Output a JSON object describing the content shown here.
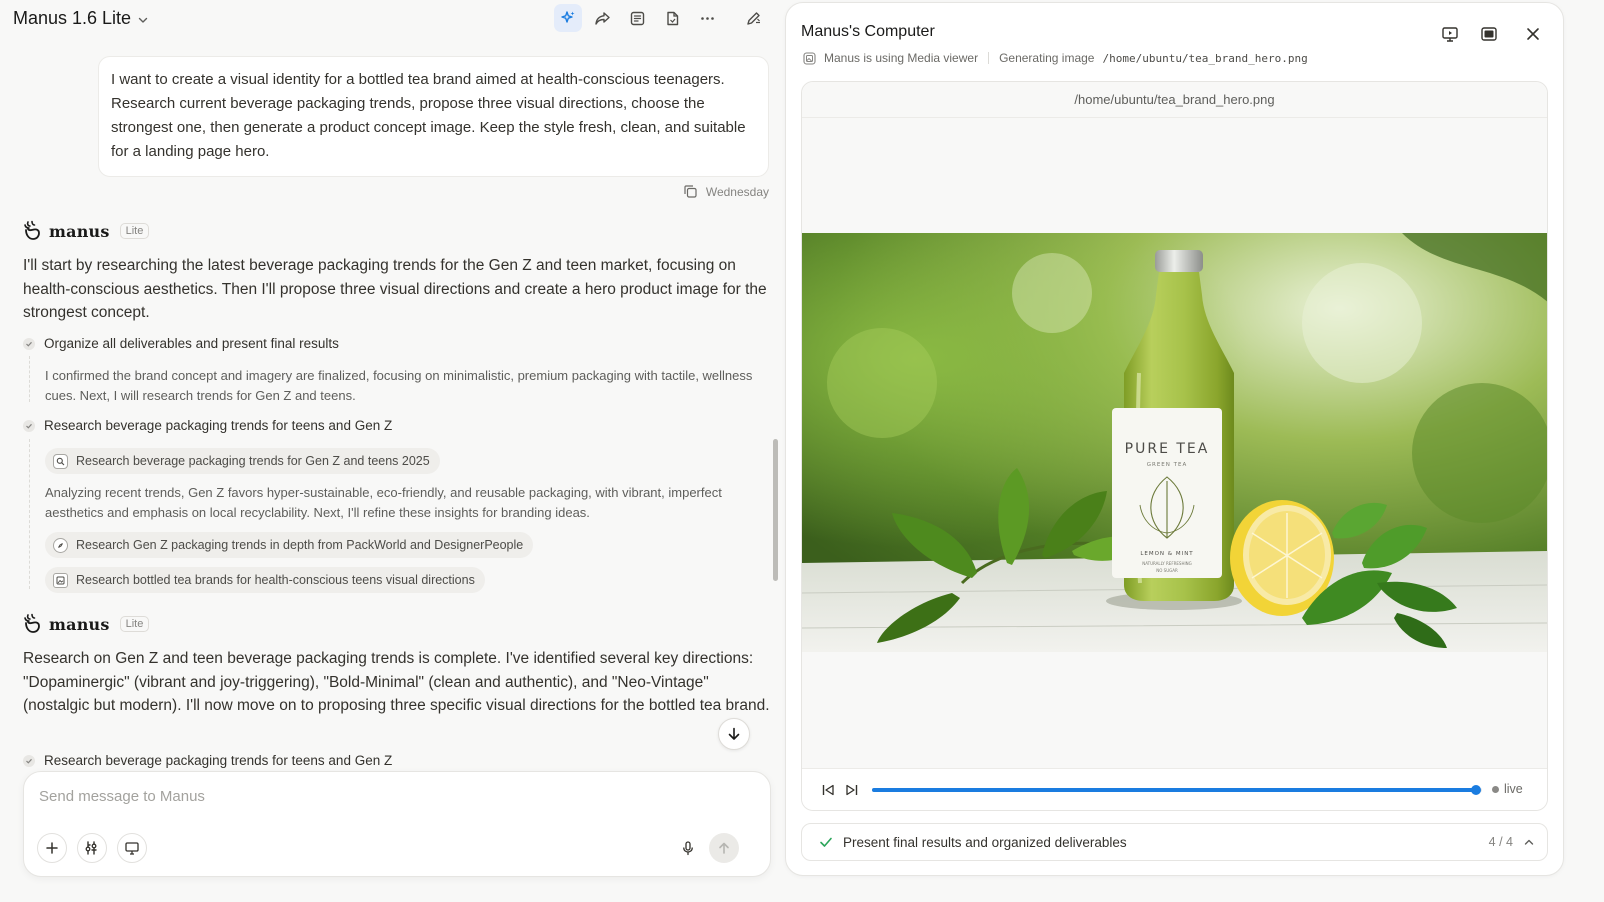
{
  "header": {
    "app_title": "Manus 1.6 Lite"
  },
  "user_message": {
    "text": "I want to create a visual identity for a bottled tea brand aimed at health-conscious teenagers. Research current beverage packaging trends, propose three visual directions, choose the strongest one, then generate a product concept image. Keep the style fresh, clean, and suitable for a landing page hero.",
    "day": "Wednesday"
  },
  "assistant_1": {
    "name": "manus",
    "badge": "Lite",
    "text": "I'll start by researching the latest beverage packaging trends for the Gen Z and teen market, focusing on health-conscious aesthetics. Then I'll propose three visual directions and create a hero product image for the strongest concept.",
    "step_1": {
      "title": "Organize all deliverables and present final results",
      "body": "I confirmed the brand concept and imagery are finalized, focusing on minimalistic, premium packaging with tactile, wellness cues. Next, I will research trends for Gen Z and teens."
    },
    "step_2": {
      "title": "Research beverage packaging trends for teens and Gen Z",
      "chip_1": "Research beverage packaging trends for Gen Z and teens 2025",
      "body": "Analyzing recent trends, Gen Z favors hyper-sustainable, eco-friendly, and reusable packaging, with vibrant, imperfect aesthetics and emphasis on local recyclability. Next, I'll refine these insights for branding ideas.",
      "chip_2": "Research Gen Z packaging trends in depth from PackWorld and DesignerPeople",
      "chip_3": "Research bottled tea brands for health-conscious teens visual directions"
    }
  },
  "assistant_2": {
    "name": "manus",
    "badge": "Lite",
    "text": "Research on Gen Z and teen beverage packaging trends is complete. I've identified several key directions: \"Dopaminergic\" (vibrant and joy-triggering), \"Bold-Minimal\" (clean and authentic), and \"Neo-Vintage\" (nostalgic but modern). I'll now move on to proposing three specific visual directions for the bottled tea brand.",
    "step_1": {
      "title": "Research beverage packaging trends for teens and Gen Z"
    }
  },
  "composer": {
    "placeholder": "Send message to Manus"
  },
  "computer_panel": {
    "title": "Manus's Computer",
    "status_tool": "Manus is using Media viewer",
    "status_action": "Generating image",
    "status_path": "/home/ubuntu/tea_brand_hero.png",
    "viewer_title": "/home/ubuntu/tea_brand_hero.png",
    "image": {
      "bottle_brand": "PURE TEA",
      "bottle_sub": "GREEN TEA",
      "bottle_flavor": "LEMON & MINT",
      "bottle_line_1": "NATURALLY REFRESHING",
      "bottle_line_2": "NO SUGAR"
    },
    "playback": {
      "progress_fraction": 0.99,
      "live_label": "live"
    },
    "task": {
      "text": "Present final results and organized deliverables",
      "count": "4 / 4"
    }
  },
  "icons": [
    "chevron-down-icon",
    "sparkle-icon",
    "share-icon",
    "notes-icon",
    "files-icon",
    "more-icon",
    "edit-icon",
    "copy-icon",
    "manus-logo-icon",
    "check-icon",
    "search-icon",
    "browser-icon",
    "image-icon",
    "arrow-down-icon",
    "plus-icon",
    "tools-icon",
    "monitor-icon",
    "mic-icon",
    "send-icon",
    "screen-icon",
    "fullscreen-icon",
    "close-icon",
    "media-viewer-icon",
    "skip-back-icon",
    "skip-forward-icon",
    "chevron-up-icon"
  ],
  "colors": {
    "accent": "#1a7ce0",
    "background": "#f8f8f7",
    "check_green": "#2ba55a"
  }
}
